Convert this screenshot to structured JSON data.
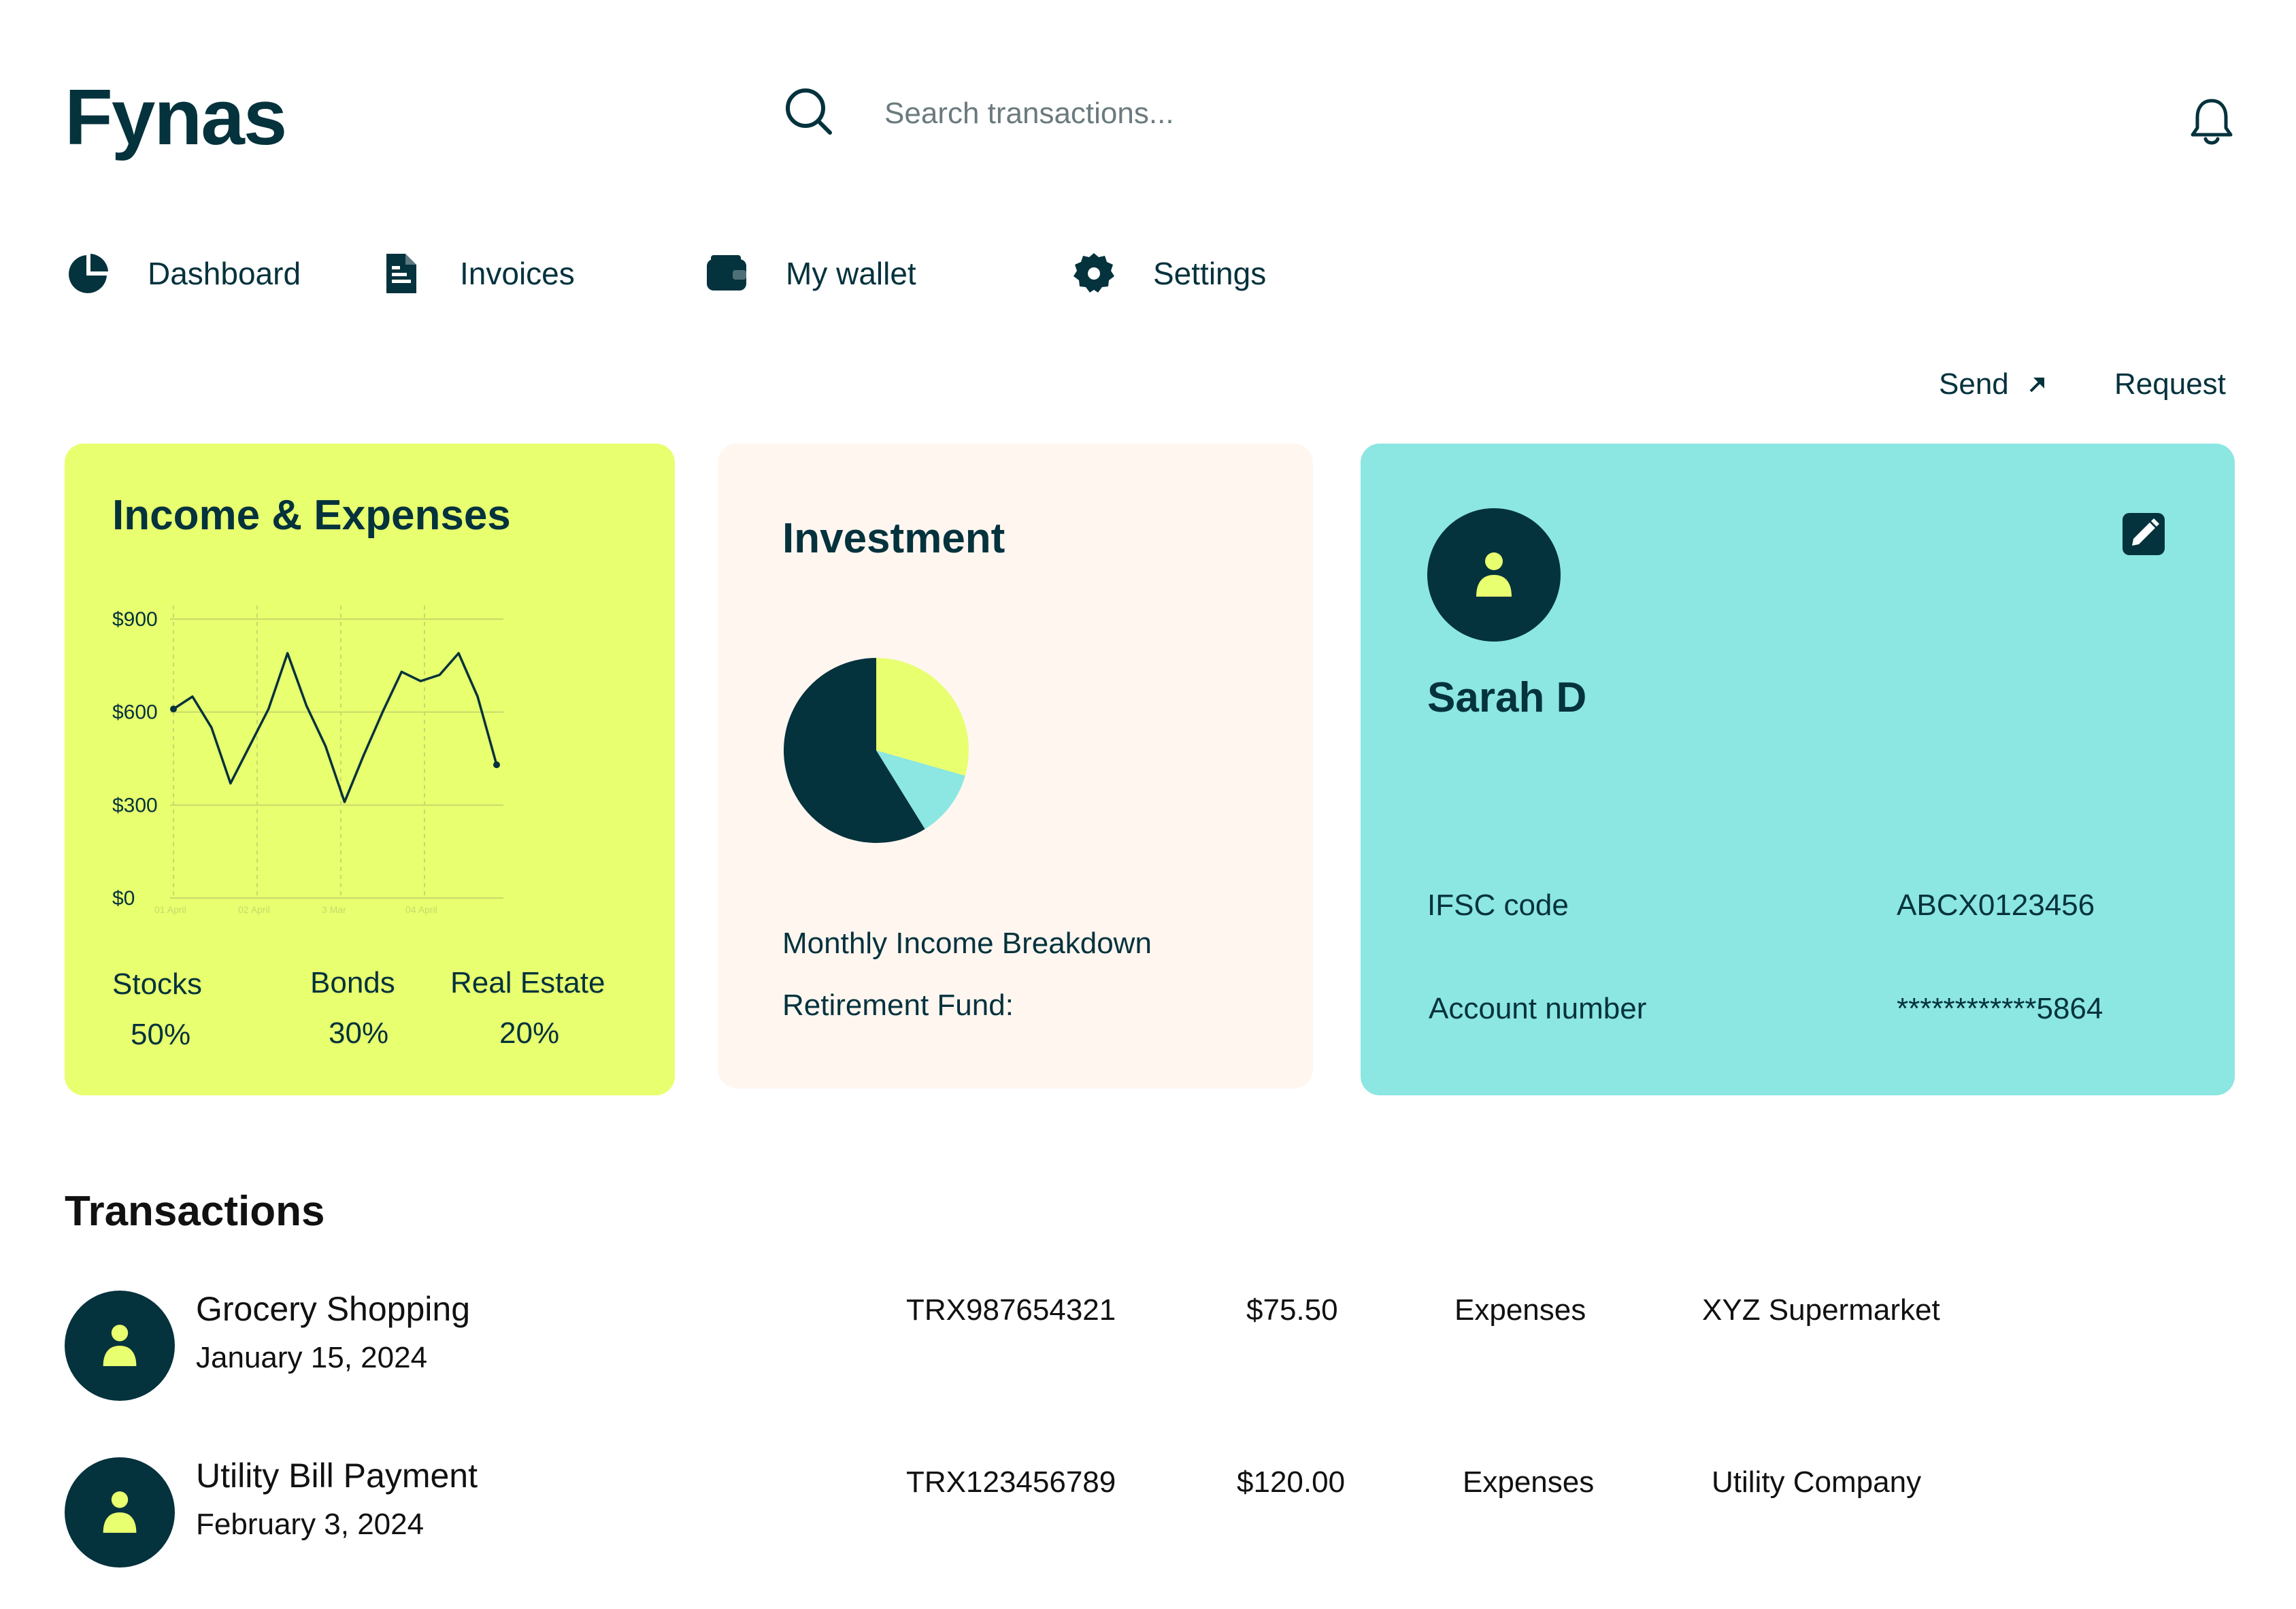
{
  "app": {
    "name": "Fynas"
  },
  "search": {
    "placeholder": "Search transactions..."
  },
  "nav": {
    "items": [
      {
        "label": "Dashboard",
        "icon": "pie-chart-icon"
      },
      {
        "label": "Invoices",
        "icon": "document-icon"
      },
      {
        "label": "My wallet",
        "icon": "wallet-icon"
      },
      {
        "label": "Settings",
        "icon": "gear-icon"
      }
    ]
  },
  "actions": {
    "send_label": "Send",
    "request_label": "Request"
  },
  "income_card": {
    "title": "Income & Expenses",
    "legend": [
      {
        "label": "Stocks",
        "percent": "50%"
      },
      {
        "label": "Bonds",
        "percent": "30%"
      },
      {
        "label": "Real Estate",
        "percent": "20%"
      }
    ]
  },
  "investment_card": {
    "title": "Investment",
    "line1": "Monthly Income Breakdown",
    "line2": "Retirement Fund:"
  },
  "profile_card": {
    "name": "Sarah D",
    "ifsc_label": "IFSC code",
    "ifsc_value": "ABCX0123456",
    "account_label": "Account number",
    "account_value": "************5864"
  },
  "transactions": {
    "heading": "Transactions",
    "rows": [
      {
        "title": "Grocery Shopping",
        "date": "January 15, 2024",
        "id": "TRX987654321",
        "amount": "$75.50",
        "type": "Expenses",
        "merchant": "XYZ Supermarket"
      },
      {
        "title": "Utility Bill Payment",
        "date": "February 3, 2024",
        "id": "TRX123456789",
        "amount": "$120.00",
        "type": "Expenses",
        "merchant": "Utility Company"
      }
    ]
  },
  "colors": {
    "primary": "#04323d",
    "lime": "#e8ff6f",
    "cream": "#fff6f0",
    "aqua": "#8ce6e1"
  },
  "chart_data": [
    {
      "type": "line",
      "title": "",
      "y_tick_labels": [
        "$0",
        "$300",
        "$600",
        "$900"
      ],
      "ylim": [
        0,
        900
      ],
      "x_tick_labels": [
        "01 April",
        "02 April",
        "3 Mar",
        "04 April"
      ],
      "series": [
        {
          "values": [
            610,
            650,
            550,
            370,
            490,
            610,
            790,
            620,
            490,
            310,
            460,
            600,
            730,
            700,
            720,
            790,
            650,
            430
          ]
        }
      ],
      "grid": true
    },
    {
      "type": "pie",
      "slices": [
        {
          "label": "Stocks",
          "value": 50,
          "color": "#04323d"
        },
        {
          "label": "Bonds",
          "value": 25,
          "color": "#e8ff6f"
        },
        {
          "label": "Real Estate",
          "value": 10,
          "color": "#8ce6e1"
        }
      ]
    }
  ]
}
